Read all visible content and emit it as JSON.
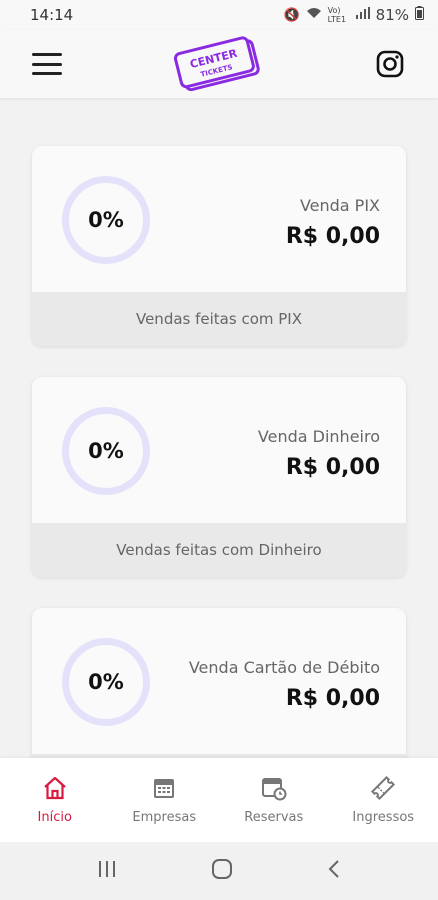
{
  "status": {
    "time": "14:14",
    "network": "Vo) LTE1",
    "battery": "81%"
  },
  "header": {
    "logo_top": "CENTER",
    "logo_bottom": "TICKETS"
  },
  "cards": [
    {
      "percent": "0%",
      "label": "Venda PIX",
      "value": "R$ 0,00",
      "footer": "Vendas feitas com PIX"
    },
    {
      "percent": "0%",
      "label": "Venda Dinheiro",
      "value": "R$ 0,00",
      "footer": "Vendas feitas com Dinheiro"
    },
    {
      "percent": "0%",
      "label": "Venda Cartão de Débito",
      "value": "R$ 0,00",
      "footer": ""
    }
  ],
  "nav": {
    "items": [
      {
        "label": "Início",
        "icon": "home-icon",
        "active": true
      },
      {
        "label": "Empresas",
        "icon": "calendar-icon"
      },
      {
        "label": "Reservas",
        "icon": "calendar-clock-icon"
      },
      {
        "label": "Ingressos",
        "icon": "ticket-icon"
      }
    ]
  },
  "colors": {
    "accent": "#d81b40",
    "ring": "#e4e2fb",
    "logo": "#8a2be2"
  }
}
